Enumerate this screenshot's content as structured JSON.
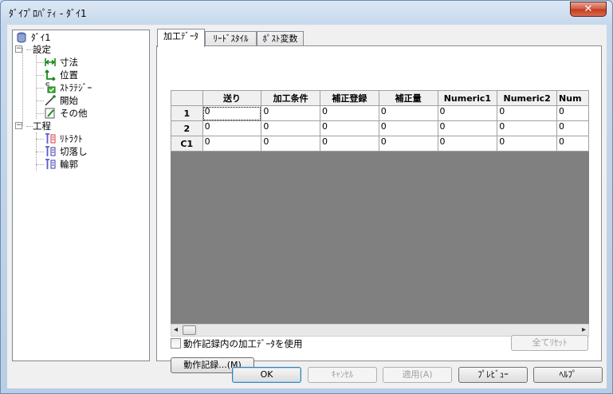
{
  "window": {
    "title": "ﾀﾞｲﾌﾟﾛﾊﾟﾃｨ - ﾀﾞｲ1",
    "close_label": "✕"
  },
  "tree": {
    "root": "ﾀﾞｲ1",
    "settings": {
      "label": "設定",
      "items": [
        "寸法",
        "位置",
        "ｽﾄﾗﾃｼﾞｰ",
        "開始",
        "その他"
      ]
    },
    "process": {
      "label": "工程",
      "items": [
        "ﾘﾄﾗｸﾄ",
        "切落し",
        "輪郭"
      ]
    }
  },
  "tabs": [
    "加工ﾃﾞｰﾀ",
    "ﾘｰﾄﾞｽﾀｲﾙ",
    "ﾎﾟｽﾄ変数"
  ],
  "grid": {
    "columns": [
      "送り",
      "加工条件",
      "補正登録",
      "補正量",
      "Numeric1",
      "Numeric2",
      "Num"
    ],
    "rows": [
      {
        "label": "1",
        "values": [
          "0",
          "0",
          "0",
          "0",
          "0",
          "0",
          "0"
        ]
      },
      {
        "label": "2",
        "values": [
          "0",
          "0",
          "0",
          "0",
          "0",
          "0",
          "0"
        ]
      },
      {
        "label": "C1",
        "values": [
          "0",
          "0",
          "0",
          "0",
          "0",
          "0",
          "0"
        ]
      }
    ]
  },
  "options": {
    "use_recorded_label": "動作記録内の加工ﾃﾞｰﾀを使用",
    "use_recorded_checked": false
  },
  "buttons": {
    "reset_all": "全てﾘｾｯﾄ",
    "action_record": "動作記録...(M)",
    "ok": "OK",
    "cancel": "ｷｬﾝｾﾙ",
    "apply": "適用(A)",
    "preview": "ﾌﾟﾚﾋﾞｭｰ",
    "help": "ﾍﾙﾌﾟ"
  },
  "scroll": {
    "left_arrow": "◂",
    "right_arrow": "▸"
  }
}
